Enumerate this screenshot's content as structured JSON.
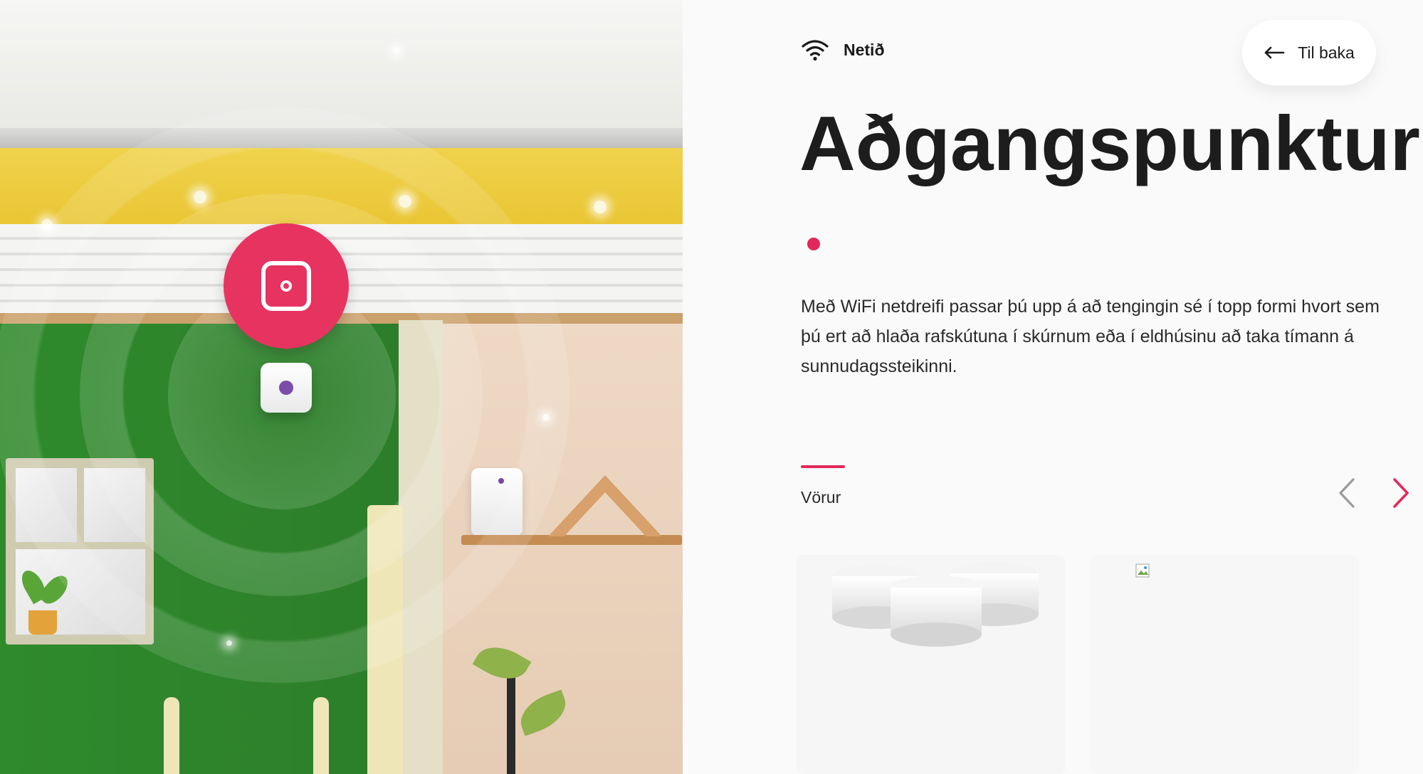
{
  "category": {
    "label": "Netið",
    "icon": "wifi-icon"
  },
  "back_button": {
    "label": "Til baka",
    "icon": "arrow-left-icon"
  },
  "page": {
    "title": "Aðgangspunktur",
    "description": "Með WiFi netdreifi passar þú upp á að tengingin sé í topp formi hvort sem þú ert að hlaða rafskútuna í skúrnum eða í eldhúsinu að taka tímann á sunnudagssteikinni."
  },
  "products": {
    "section_label": "Vörur",
    "prev_icon": "chevron-left-icon",
    "next_icon": "chevron-right-icon",
    "items": [
      {
        "image": "wifi-mesh-pucks"
      },
      {
        "image": "broken-image-icon"
      }
    ]
  },
  "scene": {
    "pin_icon": "access-point-icon",
    "device_label": "access-point-device"
  },
  "colors": {
    "accent": "#e2285a",
    "pin": "#e7335f",
    "text": "#1d1d1d",
    "panel_bg": "#fafafa",
    "arrow_disabled": "#9a9a9a"
  }
}
